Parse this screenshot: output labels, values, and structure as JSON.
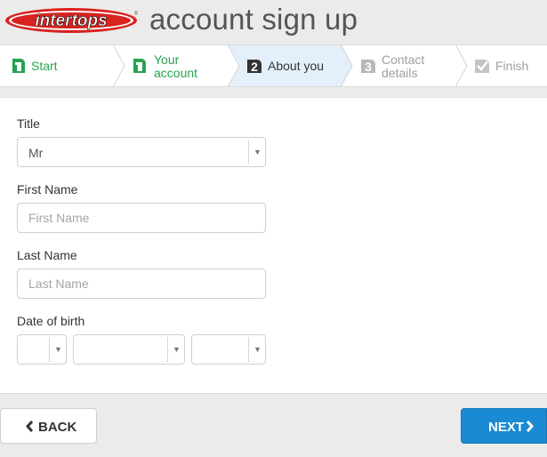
{
  "header": {
    "logo_text": "intertops",
    "title": "account sign up"
  },
  "stepper": {
    "steps": [
      {
        "number": "1",
        "label": "Start",
        "state": "done"
      },
      {
        "number": "1",
        "label_line1": "Your",
        "label_line2": "account",
        "state": "done"
      },
      {
        "number": "2",
        "label": "About you",
        "state": "active"
      },
      {
        "number": "3",
        "label_line1": "Contact",
        "label_line2": "details",
        "state": "todo"
      },
      {
        "number": "",
        "label": "Finish",
        "state": "todo"
      }
    ]
  },
  "form": {
    "title": {
      "label": "Title",
      "value": "Mr"
    },
    "first_name": {
      "label": "First Name",
      "placeholder": "First Name",
      "value": ""
    },
    "last_name": {
      "label": "Last Name",
      "placeholder": "Last Name",
      "value": ""
    },
    "dob": {
      "label": "Date of birth",
      "day": "",
      "month": "",
      "year": ""
    }
  },
  "footer": {
    "back_label": "BACK",
    "next_label": "NEXT"
  },
  "colors": {
    "done": "#27a34f",
    "active_bg": "#e3f0fb",
    "primary": "#1a8ad2",
    "logo_red": "#d8231f"
  },
  "icons": {
    "back": "chevron-left-icon",
    "next": "chevron-right-icon",
    "dropdown": "caret-down-icon",
    "finish": "checkmark-icon"
  }
}
